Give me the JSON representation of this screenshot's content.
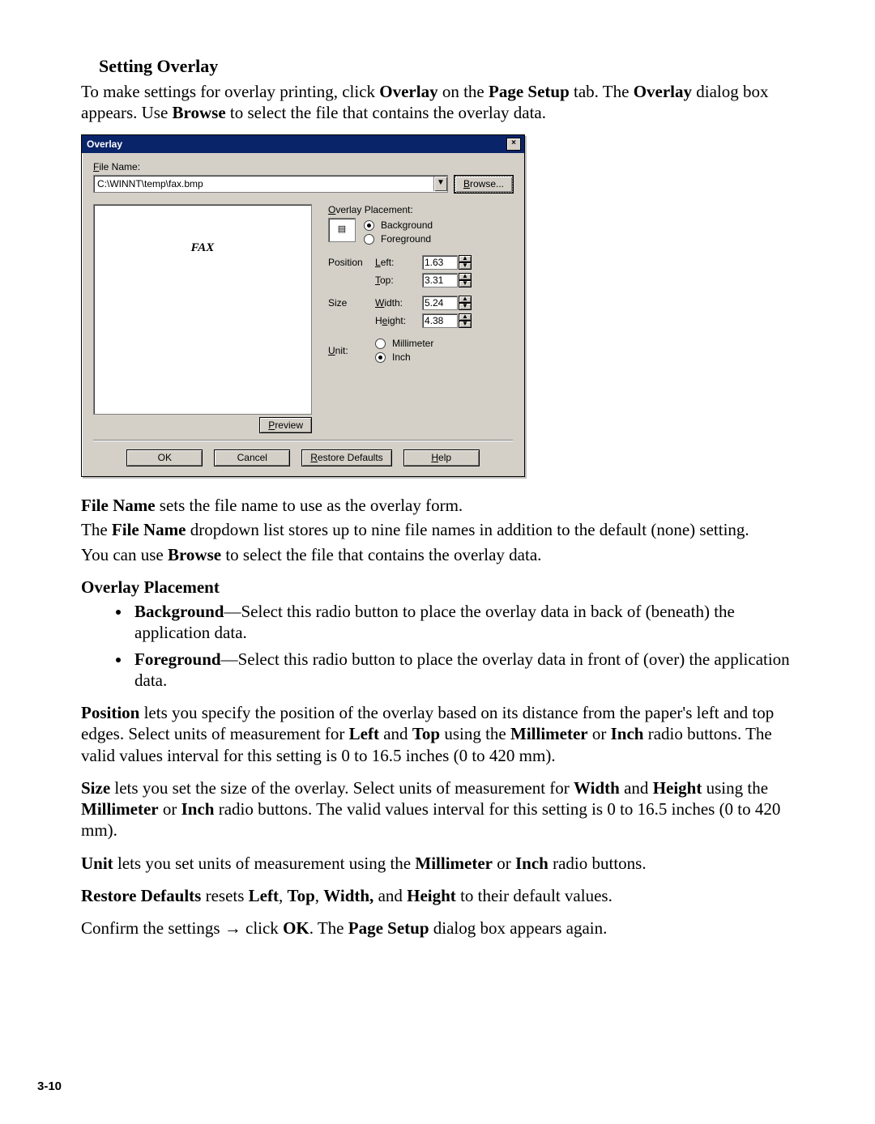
{
  "doc": {
    "heading": "Setting Overlay",
    "intro_html": "To make settings for overlay printing, click <b>Overlay</b> on the <b>Page Setup</b> tab. The <b>Overlay</b> dialog box appears. Use <b>Browse</b> to select the file that contains the overlay data.",
    "file_name_1_html": "<b>File Name</b> sets the file name to use as the overlay form.",
    "file_name_2_html": "The <b>File Name</b> dropdown list stores up to nine file names in addition to the default (none) setting.",
    "file_name_3_html": "You can use <b>Browse</b> to select the file that contains the overlay data.",
    "placement_head": "Overlay Placement",
    "placement_bg_html": "<b>Background</b>—Select this radio button to place the overlay data in back of (beneath) the application data.",
    "placement_fg_html": "<b>Foreground</b>—Select this radio button to place the overlay data in front of (over) the application data.",
    "position_html": "<b>Position</b> lets you specify the position of the overlay based on its distance from the paper's left and top edges. Select units of measurement for <b>Left</b> and <b>Top</b> using the <b>Millimeter</b> or <b>Inch</b> radio buttons. The valid values interval for this setting is 0 to 16.5 inches (0 to 420 mm).",
    "size_html": "<b>Size</b> lets you set the size of the overlay. Select units of measurement for <b>Width</b> and <b>Height</b> using the <b>Millimeter</b> or <b>Inch</b> radio buttons. The valid values interval for this setting is 0 to 16.5 inches (0 to 420 mm).",
    "unit_html": "<b>Unit</b> lets you set units of measurement using the <b>Millimeter</b> or <b>Inch</b> radio buttons.",
    "restore_html": "<b>Restore Defaults</b> resets <b>Left</b>, <b>Top</b>, <b>Width,</b> and <b>Height</b> to their default values.",
    "confirm_html": "Confirm the settings <span class='arrow'>→</span> click <b>OK</b>. The <b>Page Setup</b> dialog box appears again.",
    "page_number": "3-10"
  },
  "dlg": {
    "title": "Overlay",
    "file_name_label": "File Name:",
    "file_name_value": "C:\\WINNT\\temp\\fax.bmp",
    "browse": "Browse...",
    "preview_text": "FAX",
    "preview_btn": "Preview",
    "placement_label": "Overlay Placement:",
    "placement_bg": "Background",
    "placement_fg": "Foreground",
    "placement_selected": "bg",
    "position_label": "Position",
    "size_label": "Size",
    "unit_label": "Unit:",
    "left_label": "Left:",
    "top_label": "Top:",
    "width_label": "Width:",
    "height_label": "Height:",
    "left": "1.63",
    "top": "3.31",
    "width": "5.24",
    "height": "4.38",
    "unit_mm": "Millimeter",
    "unit_in": "Inch",
    "unit_selected": "in",
    "buttons": {
      "ok": "OK",
      "cancel": "Cancel",
      "restore": "Restore Defaults",
      "help": "Help"
    }
  }
}
